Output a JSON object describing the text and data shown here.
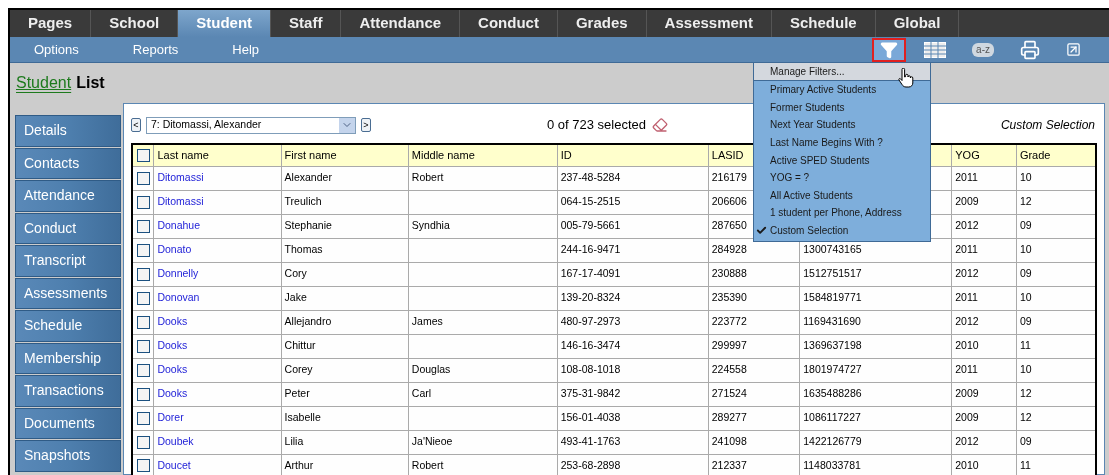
{
  "tabs": [
    {
      "label": "Pages",
      "selected": false
    },
    {
      "label": "School",
      "selected": false
    },
    {
      "label": "Student",
      "selected": true
    },
    {
      "label": "Staff",
      "selected": false
    },
    {
      "label": "Attendance",
      "selected": false
    },
    {
      "label": "Conduct",
      "selected": false
    },
    {
      "label": "Grades",
      "selected": false
    },
    {
      "label": "Assessment",
      "selected": false
    },
    {
      "label": "Schedule",
      "selected": false
    },
    {
      "label": "Global",
      "selected": false
    }
  ],
  "menu": [
    "Options",
    "Reports",
    "Help"
  ],
  "toolbar": [
    {
      "kind": "filter",
      "selected": true
    },
    {
      "kind": "grid",
      "selected": false
    },
    {
      "kind": "sort",
      "label": "a-z",
      "selected": false
    },
    {
      "kind": "print",
      "selected": false
    },
    {
      "kind": "popout",
      "selected": false
    }
  ],
  "page_title": {
    "link": "Student",
    "rest": "List"
  },
  "sidebar": {
    "items": [
      "Details",
      "Contacts",
      "Attendance",
      "Conduct",
      "Transcript",
      "Assessments",
      "Schedule",
      "Membership",
      "Transactions",
      "Documents",
      "Snapshots"
    ]
  },
  "navigator": {
    "prev": "<",
    "record": "7: Ditomassi, Alexander",
    "next": ">"
  },
  "selection_count": "0 of 723 selected",
  "current_filter": "Custom Selection",
  "table": {
    "all_checked": false,
    "columns": [
      "Last name",
      "First name",
      "Middle name",
      "ID",
      "LASID",
      null,
      "YOG",
      "Grade"
    ],
    "rows": [
      {
        "checked": false,
        "cells": [
          "Ditomassi",
          "Alexander",
          "Robert",
          "237-48-5284",
          "216179",
          null,
          "2011",
          "10"
        ]
      },
      {
        "checked": false,
        "cells": [
          "Ditomassi",
          "Treulich",
          "",
          "064-15-2515",
          "206606",
          null,
          "2009",
          "12"
        ]
      },
      {
        "checked": false,
        "cells": [
          "Donahue",
          "Stephanie",
          "Syndhia",
          "005-79-5661",
          "287650",
          null,
          "2012",
          "09"
        ]
      },
      {
        "checked": false,
        "cells": [
          "Donato",
          "Thomas",
          "",
          "244-16-9471",
          "284928",
          "1300743165",
          "2011",
          "10"
        ]
      },
      {
        "checked": false,
        "cells": [
          "Donnelly",
          "Cory",
          "",
          "167-17-4091",
          "230888",
          "1512751517",
          "2012",
          "09"
        ]
      },
      {
        "checked": false,
        "cells": [
          "Donovan",
          "Jake",
          "",
          "139-20-8324",
          "235390",
          "1584819771",
          "2011",
          "10"
        ]
      },
      {
        "checked": false,
        "cells": [
          "Dooks",
          "Allejandro",
          "James",
          "480-97-2973",
          "223772",
          "1169431690",
          "2012",
          "09"
        ]
      },
      {
        "checked": false,
        "cells": [
          "Dooks",
          "Chittur",
          "",
          "146-16-3474",
          "299997",
          "1369637198",
          "2010",
          "11"
        ]
      },
      {
        "checked": false,
        "cells": [
          "Dooks",
          "Corey",
          "Douglas",
          "108-08-1018",
          "224558",
          "1801974727",
          "2011",
          "10"
        ]
      },
      {
        "checked": false,
        "cells": [
          "Dooks",
          "Peter",
          "Carl",
          "375-31-9842",
          "271524",
          "1635488286",
          "2009",
          "12"
        ]
      },
      {
        "checked": false,
        "cells": [
          "Dorer",
          "Isabelle",
          "",
          "156-01-4038",
          "289277",
          "1086117227",
          "2009",
          "12"
        ]
      },
      {
        "checked": false,
        "cells": [
          "Doubek",
          "Lilia",
          "Ja'Nieoe",
          "493-41-1763",
          "241098",
          "1422126779",
          "2012",
          "09"
        ]
      },
      {
        "checked": false,
        "cells": [
          "Doucet",
          "Arthur",
          "Robert",
          "253-68-2898",
          "212337",
          "1148033781",
          "2010",
          "11"
        ]
      }
    ]
  },
  "filter_menu": {
    "manage": "Manage Filters...",
    "items": [
      {
        "label": "Primary Active Students",
        "checked": false
      },
      {
        "label": "Former Students",
        "checked": false
      },
      {
        "label": "Next Year Students",
        "checked": false
      },
      {
        "label": "Last Name Begins With ?",
        "checked": false
      },
      {
        "label": "Active SPED Students",
        "checked": false
      },
      {
        "label": "YOG = ?",
        "checked": false
      },
      {
        "label": "All Active Students",
        "checked": false
      },
      {
        "label": "1 student per Phone, Address",
        "checked": false
      },
      {
        "label": "Custom Selection",
        "checked": true
      }
    ]
  }
}
